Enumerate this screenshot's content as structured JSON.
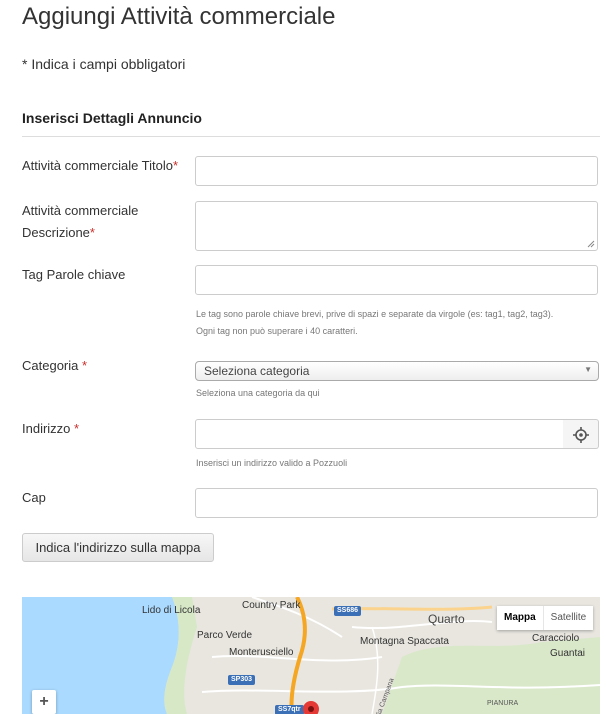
{
  "page": {
    "title": "Aggiungi Attività commerciale",
    "required_note": "* Indica i campi obbligatori"
  },
  "section": {
    "title": "Inserisci Dettagli Annuncio"
  },
  "fields": {
    "title": {
      "label": "Attività commerciale Titolo",
      "required_mark": "*",
      "value": ""
    },
    "description": {
      "label_line1": "Attività commerciale",
      "label_line2": "Descrizione",
      "required_mark": "*",
      "value": ""
    },
    "tags": {
      "label": "Tag Parole chiave",
      "value": "",
      "help_line1": "Le tag sono parole chiave brevi, prive di spazi e separate da virgole (es: tag1, tag2, tag3).",
      "help_line2": "Ogni tag non può superare i 40 caratteri."
    },
    "category": {
      "label": "Categoria",
      "required_mark": " *",
      "selected": "Seleziona categoria",
      "help": "Seleziona una categoria da qui"
    },
    "address": {
      "label": "Indirizzo",
      "required_mark": " *",
      "value": "",
      "help": "Inserisci un indirizzo valido a Pozzuoli",
      "locate_icon": "crosshair-icon"
    },
    "zip": {
      "label": "Cap",
      "value": ""
    }
  },
  "buttons": {
    "show_on_map": "Indica l'indirizzo sulla mappa"
  },
  "map": {
    "type_control": {
      "map": "Mappa",
      "satellite": "Satellite"
    },
    "zoom_in": "+",
    "places": [
      "Lido di Licola",
      "Country Park",
      "Quarto",
      "Parco Verde",
      "Monterusciello",
      "Montagna Spaccata",
      "Caracciolo",
      "Guantai",
      "Via Campana",
      "PIANURA"
    ],
    "roads": [
      "SS686",
      "SP303",
      "SS7qtr"
    ],
    "marker_icon": "map-pin-icon"
  },
  "colors": {
    "required": "#c9302c",
    "map_water": "#aadaff",
    "map_land": "#e8e6df",
    "road": "#f5a623",
    "marker": "#e53935"
  }
}
